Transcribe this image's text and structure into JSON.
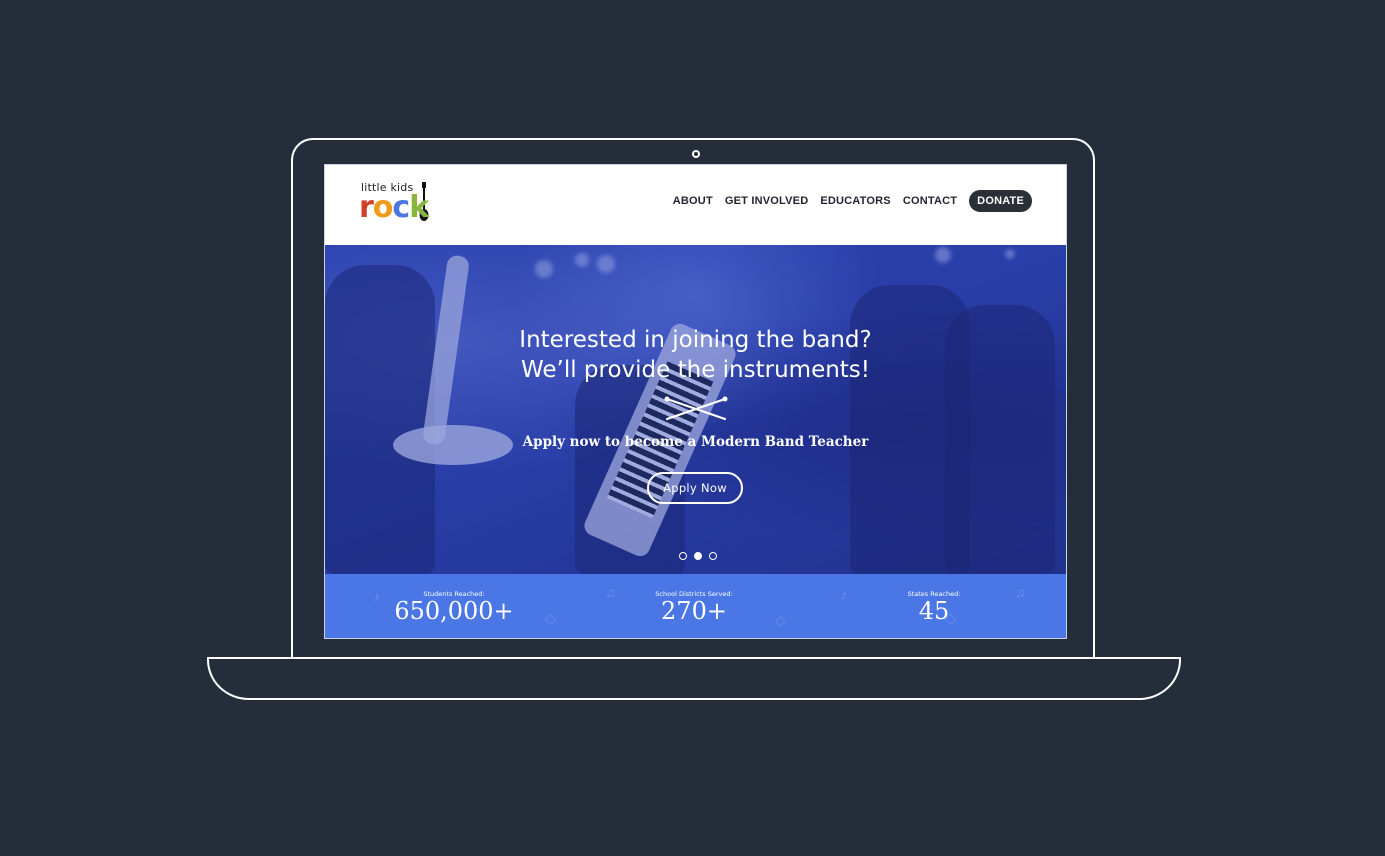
{
  "brand": {
    "logo_top": "little kids",
    "logo_letters": [
      "r",
      "o",
      "c",
      "k"
    ],
    "colors": {
      "red": "#d23f2a",
      "orange": "#f19a1c",
      "blue": "#4a77e0",
      "green": "#8ab53d"
    }
  },
  "nav": {
    "items": [
      "ABOUT",
      "GET INVOLVED",
      "EDUCATORS",
      "CONTACT"
    ],
    "donate": "DONATE"
  },
  "hero": {
    "title_line1": "Interested in joining the band?",
    "title_line2": "We’ll provide the instruments!",
    "subtitle": "Apply now to become a Modern Band Teacher",
    "button": "Apply  Now",
    "slides": 3,
    "active_slide": 2
  },
  "stats": [
    {
      "label": "Students Reached:",
      "value": "650,000+"
    },
    {
      "label": "School Districts Served:",
      "value": "270+"
    },
    {
      "label": "States Reached:",
      "value": "45"
    }
  ],
  "colors": {
    "background": "#232e3a",
    "stats_bar": "#4a76e6",
    "donate_bg": "#2b2f36"
  },
  "icons": [
    "camera-icon",
    "guitar-icon",
    "drumsticks-icon"
  ]
}
